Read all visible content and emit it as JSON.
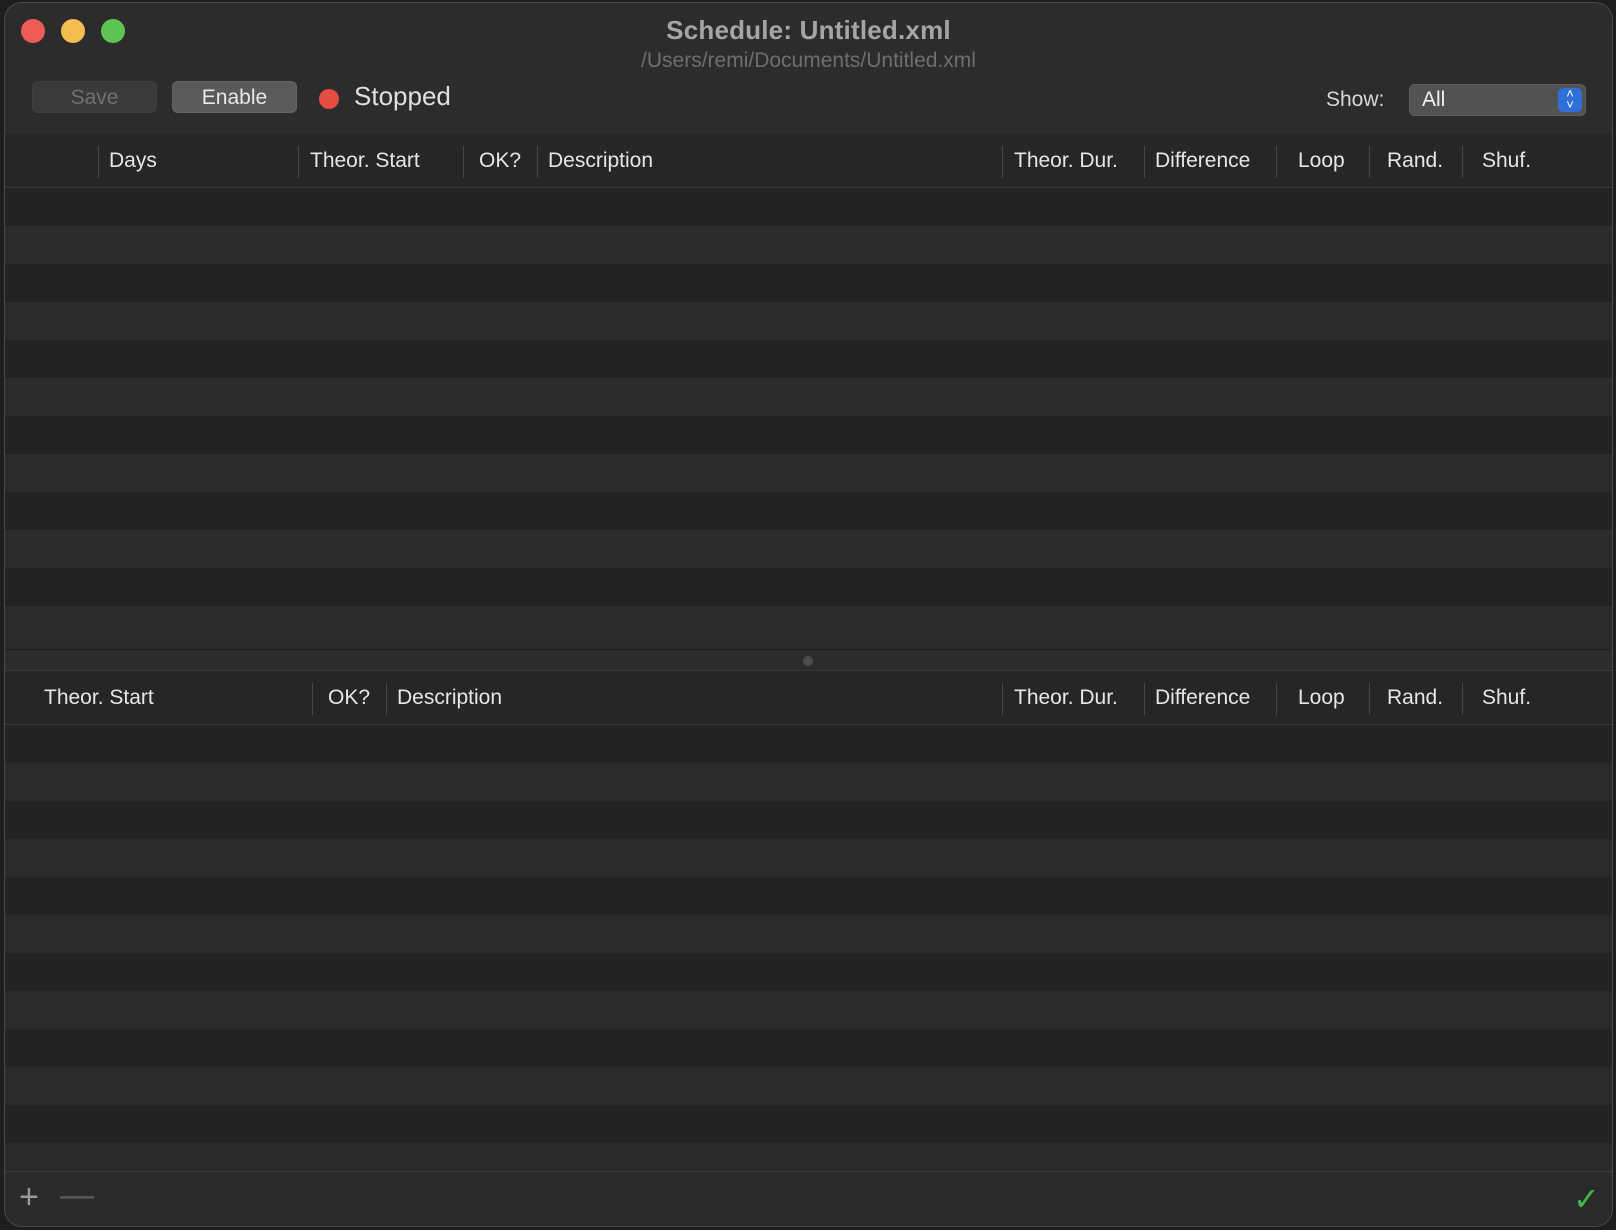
{
  "window": {
    "title": "Schedule: Untitled.xml",
    "subtitle": "/Users/remi/Documents/Untitled.xml"
  },
  "toolbar": {
    "save_label": "Save",
    "enable_label": "Enable",
    "status_text": "Stopped",
    "status_color": "#e74c44",
    "show_label": "Show:",
    "show_value": "All"
  },
  "top_table": {
    "columns": [
      "Days",
      "Theor. Start",
      "OK?",
      "Description",
      "Theor. Dur.",
      "Difference",
      "Loop",
      "Rand.",
      "Shuf."
    ]
  },
  "bottom_table": {
    "columns": [
      "Theor. Start",
      "OK?",
      "Description",
      "Theor. Dur.",
      "Difference",
      "Loop",
      "Rand.",
      "Shuf."
    ]
  },
  "footer": {
    "add_icon": "+",
    "remove_icon": "—",
    "check_icon": "✓",
    "accent": "#3fb64a"
  }
}
